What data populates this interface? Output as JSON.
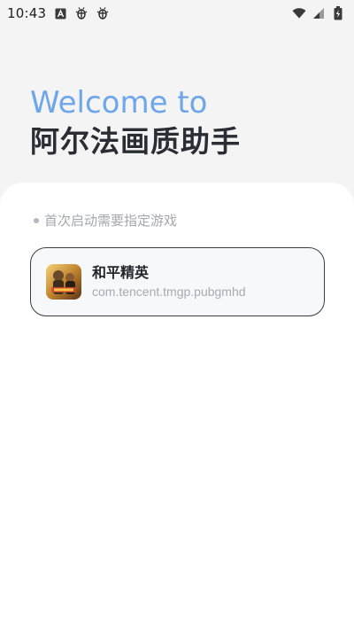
{
  "status_bar": {
    "time": "10:43",
    "icons": [
      "a-badge-icon",
      "bug-icon",
      "bug-icon",
      "wifi-icon",
      "signal-icon",
      "battery-icon"
    ]
  },
  "header": {
    "welcome": "Welcome to",
    "app_title": "阿尔法画质助手"
  },
  "main": {
    "hint": "首次启动需要指定游戏",
    "game": {
      "name": "和平精英",
      "package": "com.tencent.tmgp.pubgmhd"
    }
  },
  "colors": {
    "accent": "#6ea6ec",
    "title": "#2a2d33",
    "hint": "#a4a7b0",
    "card_border": "#3a3d44",
    "background": "#f4f4f5"
  }
}
